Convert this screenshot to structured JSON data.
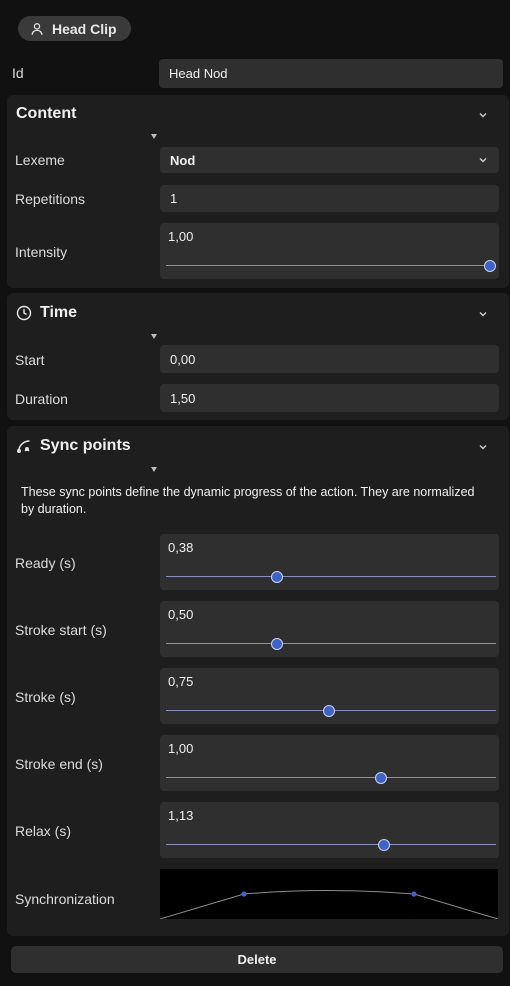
{
  "header": {
    "clip_label": "Head Clip",
    "clip_icon": "user-icon"
  },
  "id_row": {
    "label": "Id",
    "value": "Head Nod"
  },
  "content": {
    "title": "Content",
    "lexeme": {
      "label": "Lexeme",
      "value": "Nod"
    },
    "repetitions": {
      "label": "Repetitions",
      "value": "1"
    },
    "intensity": {
      "label": "Intensity",
      "value": "1,00",
      "fraction": 1.0
    }
  },
  "time": {
    "title": "Time",
    "icon": "clock-icon",
    "start": {
      "label": "Start",
      "value": "0,00"
    },
    "duration": {
      "label": "Duration",
      "value": "1,50"
    }
  },
  "sync": {
    "title": "Sync points",
    "icon": "curve-icon",
    "description": "These sync points define the dynamic progress of the action. They are normalized by duration.",
    "sliders": [
      {
        "label": "Ready (s)",
        "value": "0,38",
        "fraction": 0.34
      },
      {
        "label": "Stroke start (s)",
        "value": "0,50",
        "fraction": 0.34
      },
      {
        "label": "Stroke (s)",
        "value": "0,75",
        "fraction": 0.5
      },
      {
        "label": "Stroke end (s)",
        "value": "1,00",
        "fraction": 0.66
      },
      {
        "label": "Relax (s)",
        "value": "1,13",
        "fraction": 0.67
      }
    ],
    "synchronization": {
      "label": "Synchronization",
      "curve_color": "#8c8c8c",
      "point_color": "#3f62c4"
    }
  },
  "footer": {
    "delete_label": "Delete"
  },
  "colors": {
    "accent": "#3f62c4",
    "track": "#8a8fb8",
    "panel": "#1e1e1e",
    "field": "#2f2f2f"
  }
}
